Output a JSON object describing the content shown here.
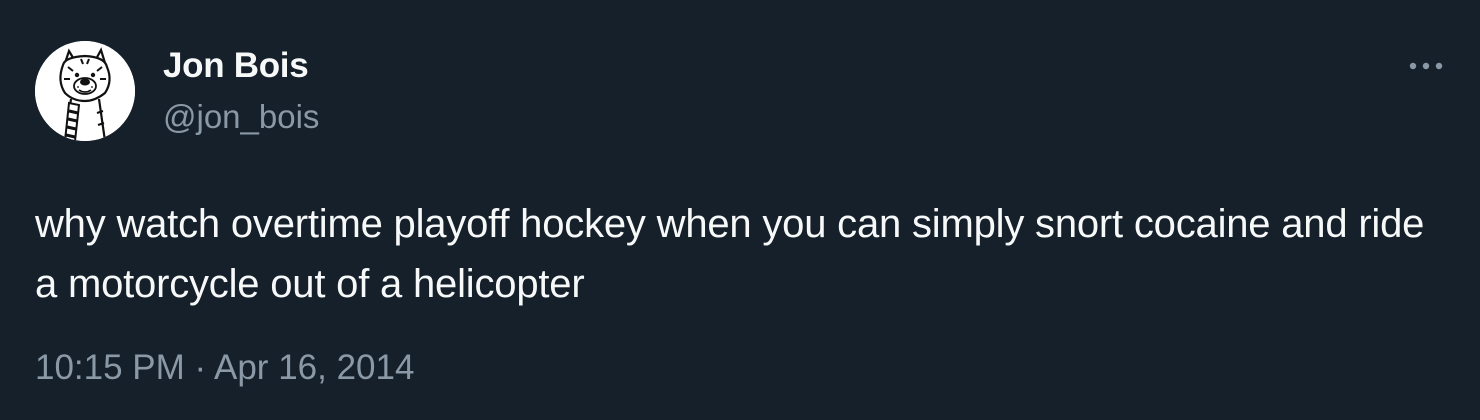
{
  "author": {
    "display_name": "Jon Bois",
    "handle": "@jon_bois",
    "avatar_icon": "cartoon-tiger-avatar"
  },
  "tweet": {
    "text": "why watch overtime playoff hockey when you can simply snort cocaine and ride a motorcycle out of a helicopter",
    "time": "10:15 PM",
    "separator": "·",
    "date": "Apr 16, 2014"
  },
  "actions": {
    "more_icon": "more-options-icon"
  },
  "colors": {
    "background": "#15202b",
    "primary_text": "#f7f9f9",
    "secondary_text": "#8b98a5"
  }
}
